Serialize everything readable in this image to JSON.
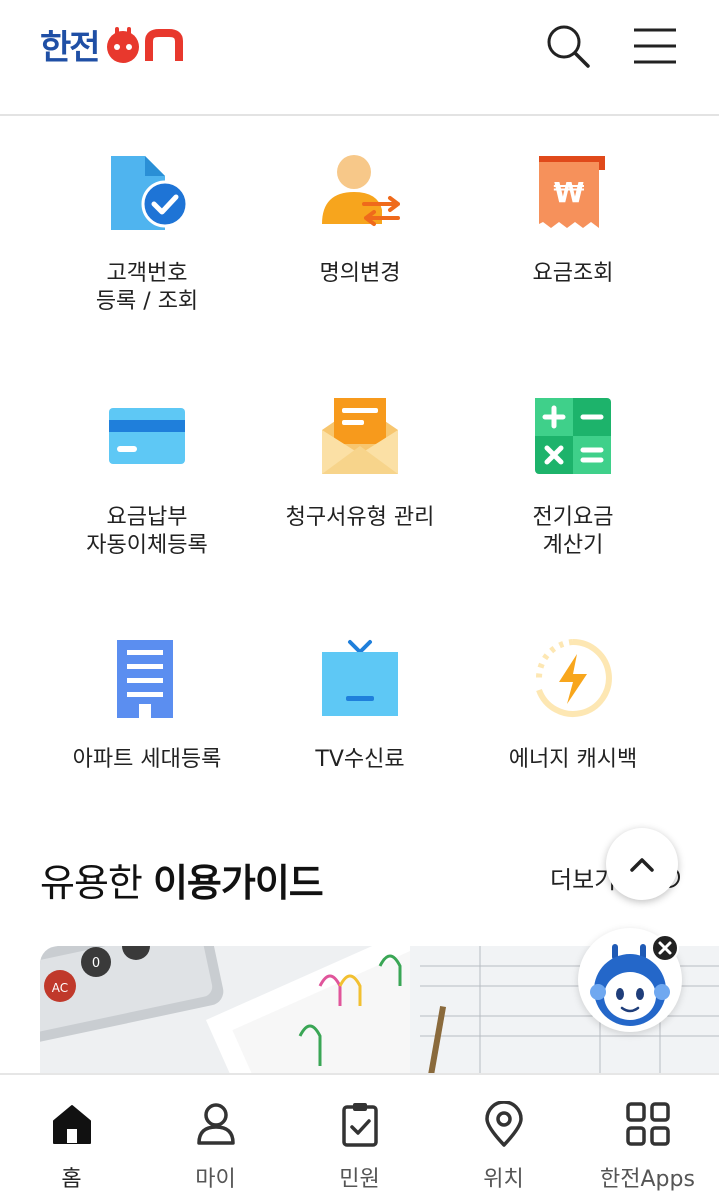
{
  "header": {
    "logo_text": "한전",
    "logo_suffix": "ON"
  },
  "menu": [
    {
      "label": "고객번호\n등록 / 조회",
      "icon": "document-check-icon"
    },
    {
      "label": "명의변경",
      "icon": "person-transfer-icon"
    },
    {
      "label": "요금조회",
      "icon": "won-receipt-icon"
    },
    {
      "label": "요금납부\n자동이체등록",
      "icon": "credit-card-icon"
    },
    {
      "label": "청구서유형 관리",
      "icon": "envelope-icon"
    },
    {
      "label": "전기요금\n계산기",
      "icon": "calculator-icon"
    },
    {
      "label": "아파트 세대등록",
      "icon": "apartment-icon"
    },
    {
      "label": "TV수신료",
      "icon": "tv-icon"
    },
    {
      "label": "에너지 캐시백",
      "icon": "energy-cashback-icon"
    }
  ],
  "guide": {
    "title_plain": "유용한 ",
    "title_bold": "이용가이드",
    "more": "더보기"
  },
  "bottom_nav": [
    {
      "label": "홈",
      "icon": "home-icon"
    },
    {
      "label": "마이",
      "icon": "person-icon"
    },
    {
      "label": "민원",
      "icon": "clipboard-check-icon"
    },
    {
      "label": "위치",
      "icon": "location-pin-icon"
    },
    {
      "label": "한전Apps",
      "icon": "apps-grid-icon"
    }
  ],
  "colors": {
    "brand_blue": "#1f4fa5",
    "brand_red": "#e8382d"
  }
}
